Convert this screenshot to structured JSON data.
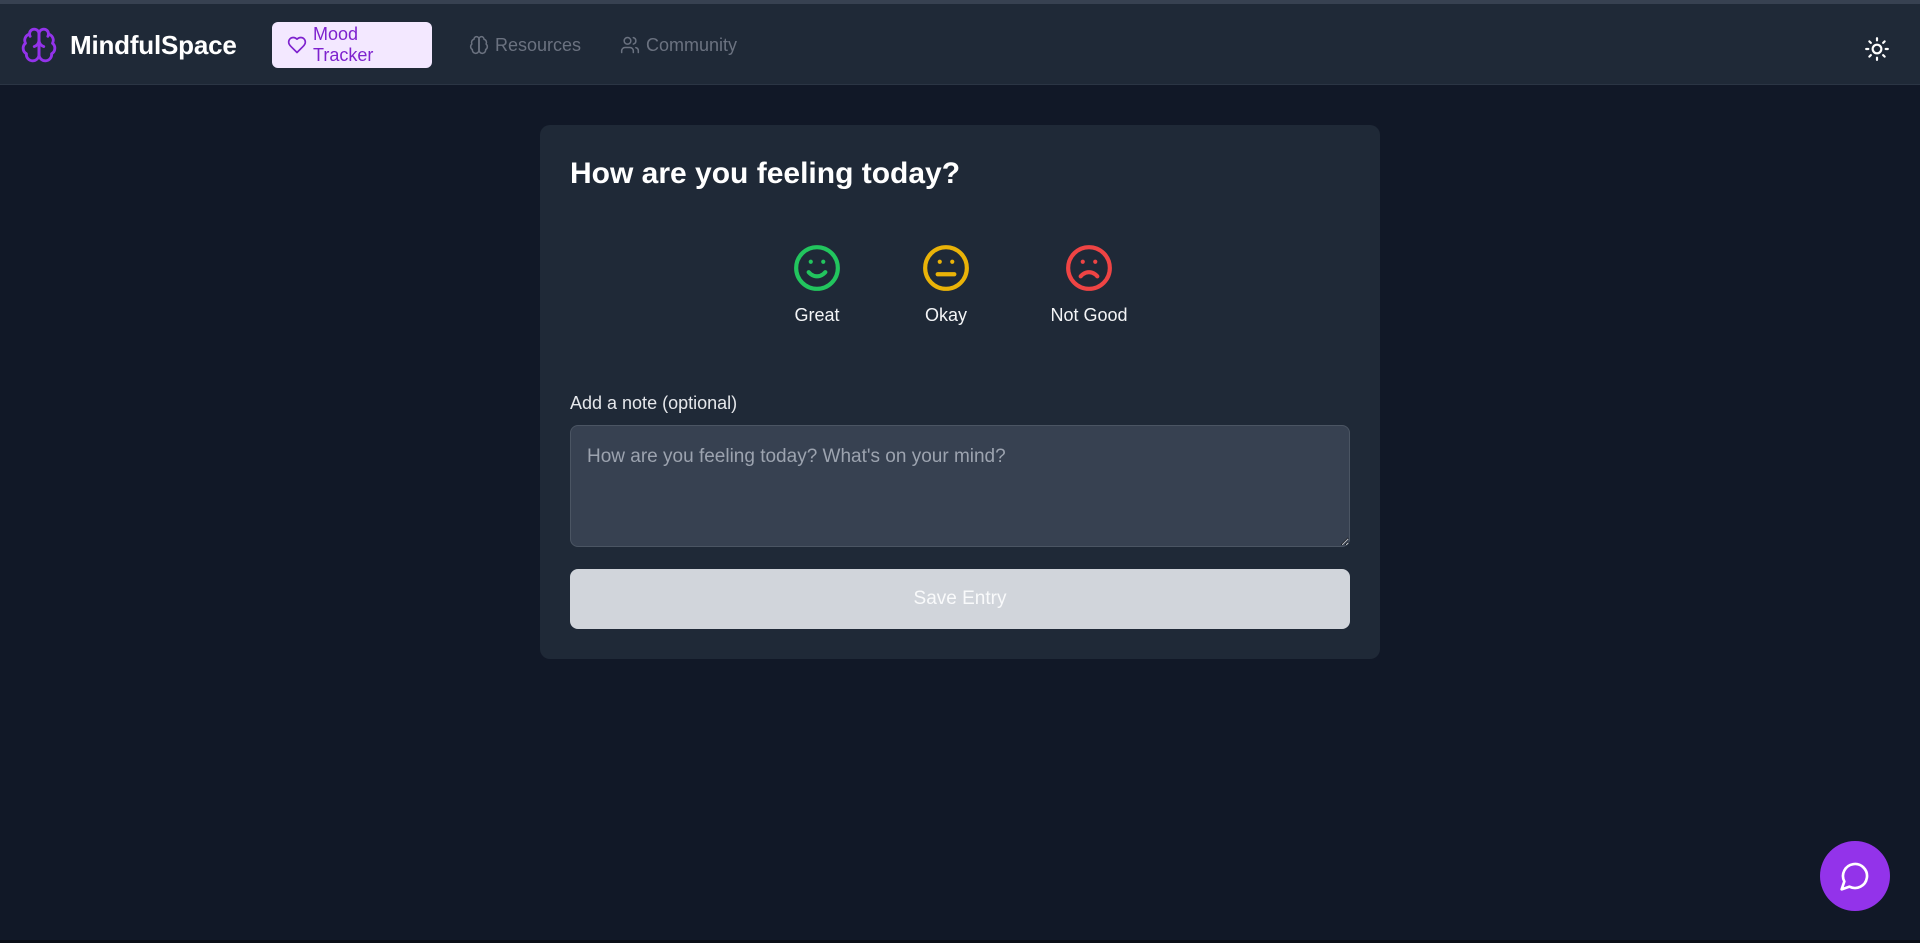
{
  "app": {
    "name": "MindfulSpace",
    "logo_icon": "brain-icon",
    "brand_color": "#9333ea"
  },
  "nav": {
    "items": [
      {
        "label": "Mood Tracker",
        "icon": "heart-icon",
        "active": true
      },
      {
        "label": "Resources",
        "icon": "brain-icon",
        "active": false
      },
      {
        "label": "Community",
        "icon": "users-icon",
        "active": false
      }
    ],
    "theme_toggle_icon": "sun-icon"
  },
  "mood_card": {
    "title": "How are you feeling today?",
    "moods": [
      {
        "label": "Great",
        "icon": "smile-icon",
        "color": "#22c55e"
      },
      {
        "label": "Okay",
        "icon": "meh-icon",
        "color": "#eab308"
      },
      {
        "label": "Not Good",
        "icon": "frown-icon",
        "color": "#ef4444"
      }
    ],
    "note_label": "Add a note (optional)",
    "note_placeholder": "How are you feeling today? What's on your mind?",
    "note_value": "",
    "save_label": "Save Entry"
  },
  "chat": {
    "icon": "message-circle-icon"
  }
}
